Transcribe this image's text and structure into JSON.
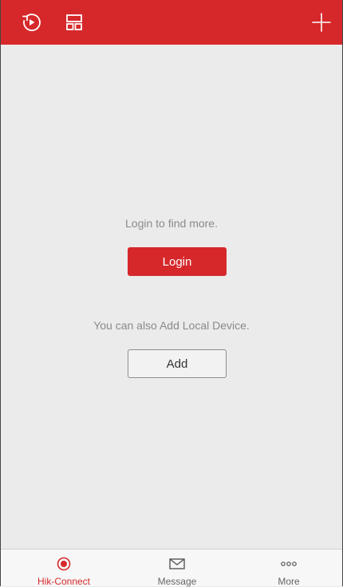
{
  "colors": {
    "accent": "#d6282b",
    "background": "#ebebeb",
    "hint_text": "#8a8a8a"
  },
  "topbar": {
    "left_icons": [
      "playback-icon",
      "layout-icon"
    ],
    "right_icon": "plus-icon"
  },
  "main": {
    "login_hint": "Login to find more.",
    "login_button": "Login",
    "add_hint": "You can also Add Local Device.",
    "add_button": "Add"
  },
  "tabs": [
    {
      "label": "Hik-Connect",
      "icon": "hik-connect-icon",
      "active": true
    },
    {
      "label": "Message",
      "icon": "envelope-icon",
      "active": false
    },
    {
      "label": "More",
      "icon": "more-dots-icon",
      "active": false
    }
  ]
}
